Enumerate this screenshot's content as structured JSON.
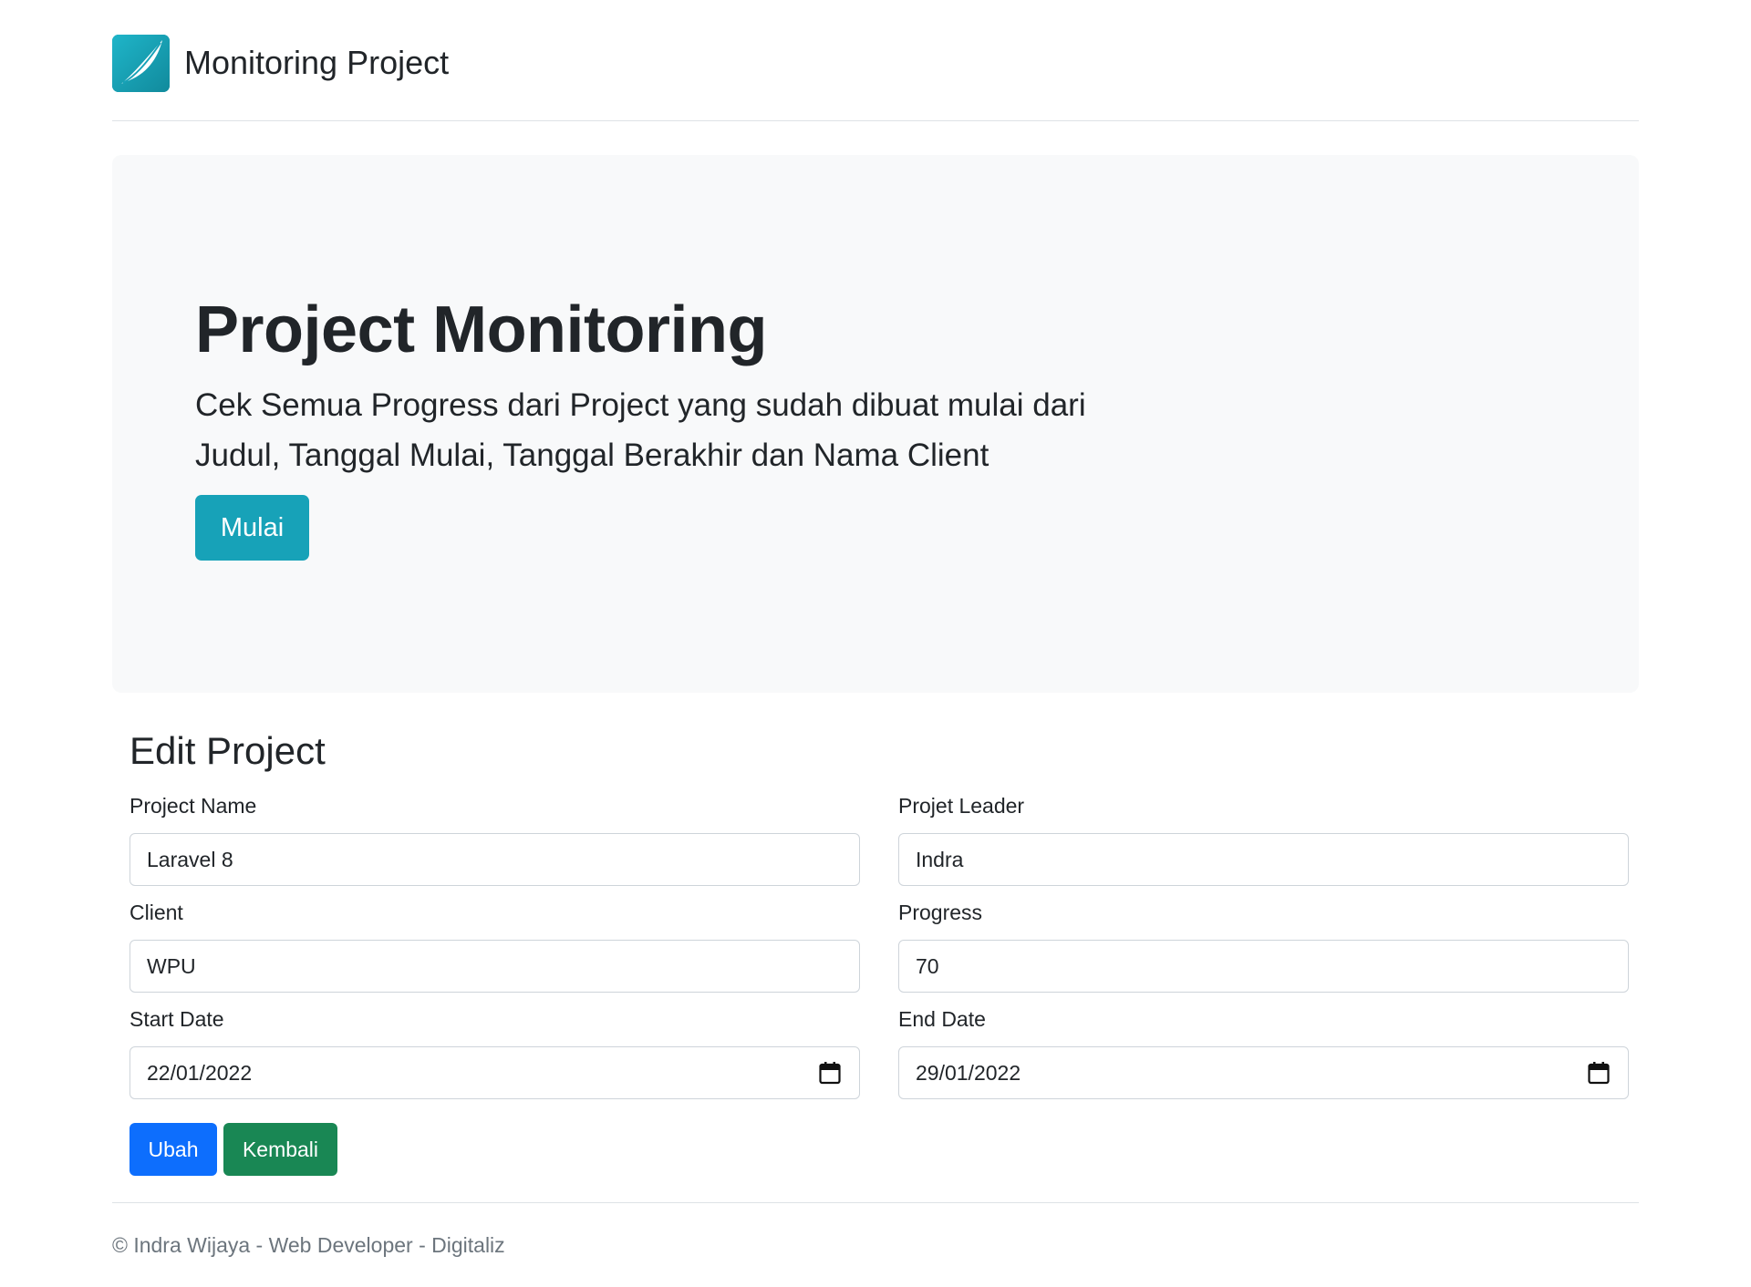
{
  "header": {
    "brand_title": "Monitoring Project",
    "logo_icon": "feather-logo-icon",
    "logo_color": "#17a2b8"
  },
  "hero": {
    "title": "Project Monitoring",
    "lead_line1": "Cek Semua Progress dari Project yang sudah dibuat mulai dari",
    "lead_line2": "Judul, Tanggal Mulai, Tanggal Berakhir dan Nama Client",
    "button_label": "Mulai"
  },
  "form": {
    "title": "Edit Project",
    "project_name": {
      "label": "Project Name",
      "value": "Laravel 8"
    },
    "project_leader": {
      "label": "Projet Leader",
      "value": "Indra"
    },
    "client": {
      "label": "Client",
      "value": "WPU"
    },
    "progress": {
      "label": "Progress",
      "value": "70"
    },
    "start_date": {
      "label": "Start Date",
      "value": "22/01/2022"
    },
    "end_date": {
      "label": "End Date",
      "value": "29/01/2022"
    },
    "submit_label": "Ubah",
    "back_label": "Kembali"
  },
  "footer": {
    "text": "© Indra Wijaya - Web Developer - Digitaliz"
  },
  "colors": {
    "primary": "#0d6efd",
    "success": "#198754",
    "info": "#17a2b8"
  }
}
